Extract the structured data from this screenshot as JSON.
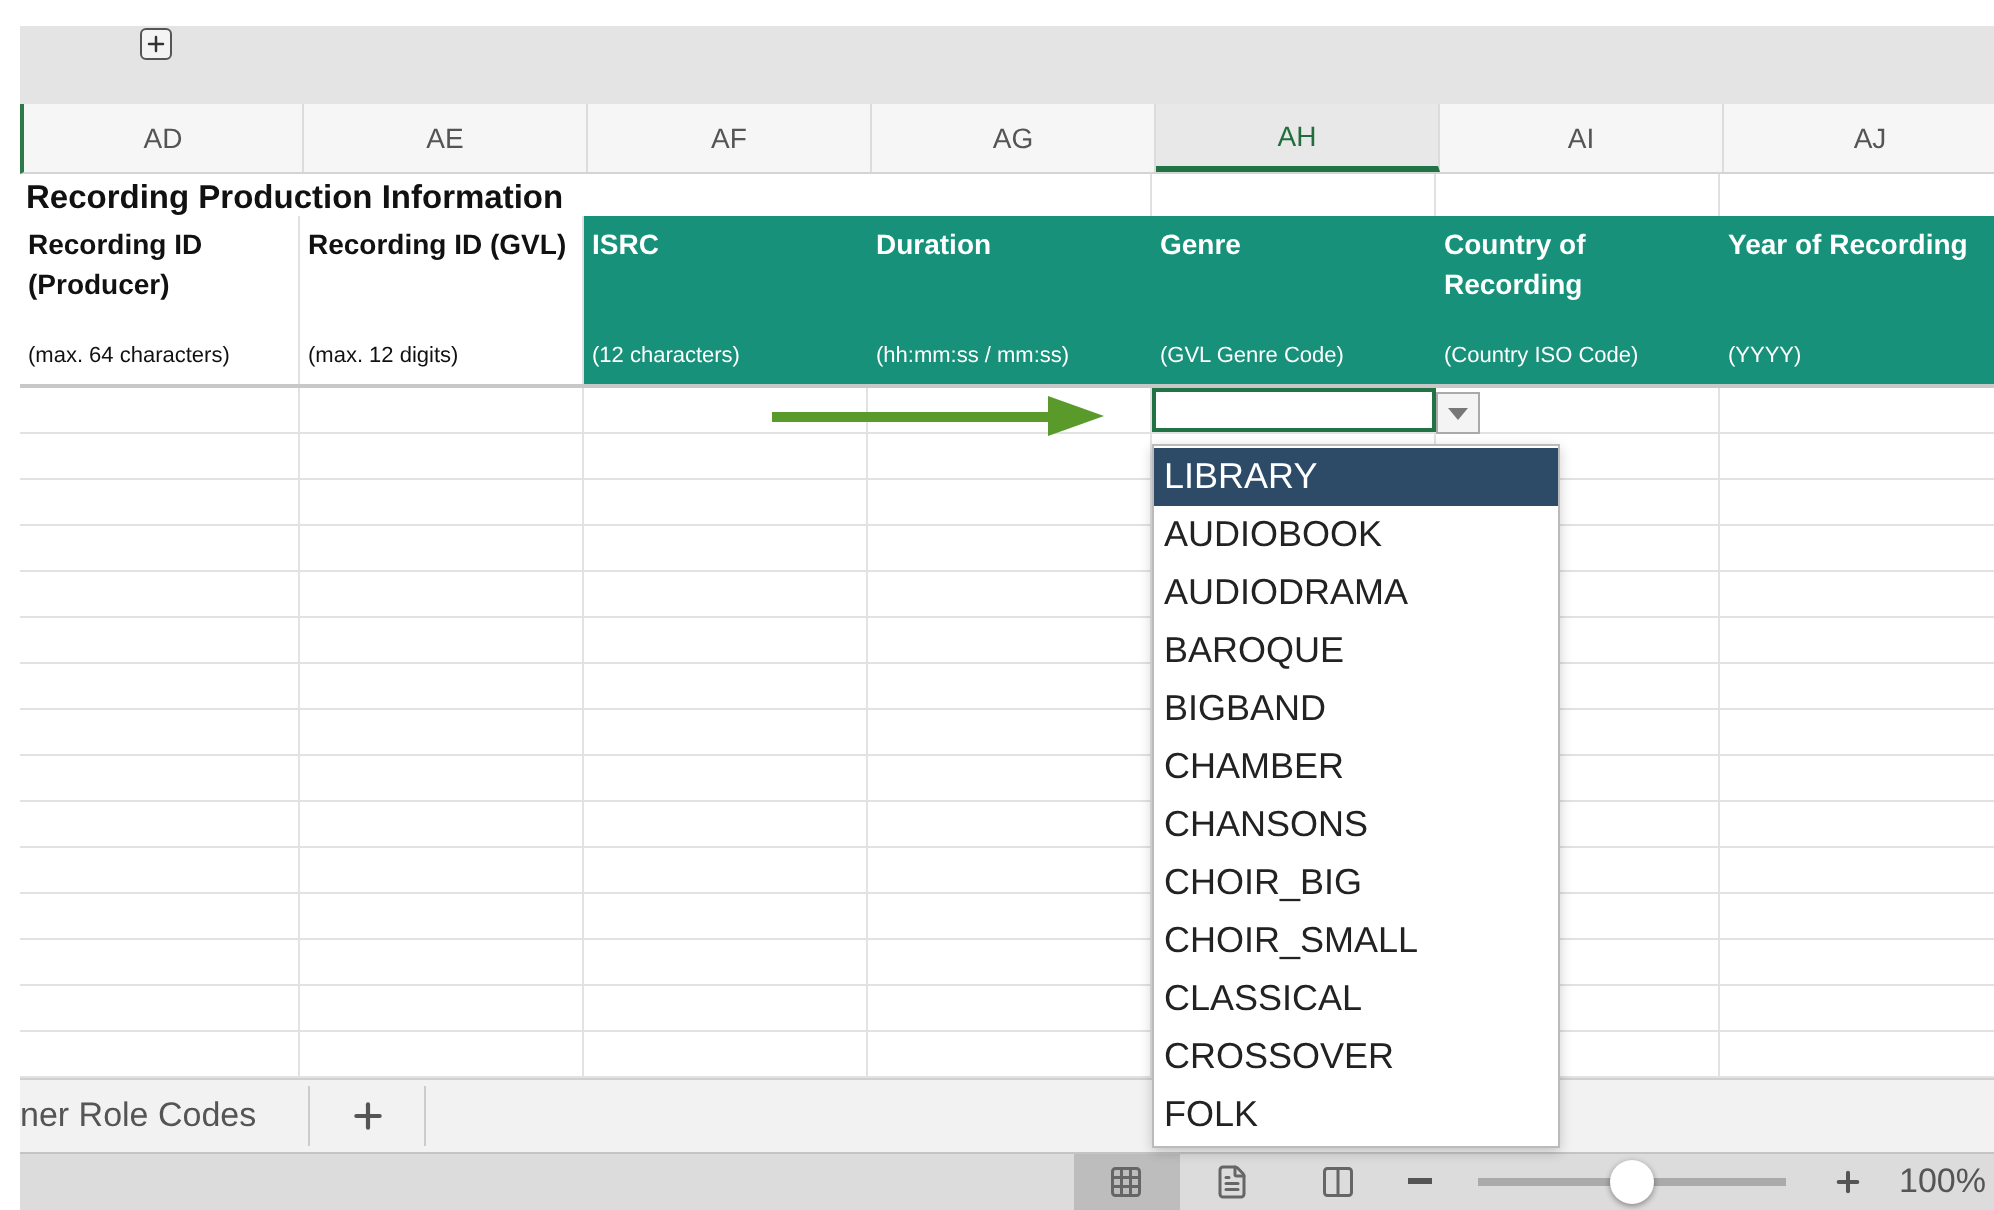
{
  "column_headers": [
    {
      "label": "AD",
      "selected": false
    },
    {
      "label": "AE",
      "selected": false
    },
    {
      "label": "AF",
      "selected": false
    },
    {
      "label": "AG",
      "selected": false
    },
    {
      "label": "AH",
      "selected": true
    },
    {
      "label": "AI",
      "selected": false
    },
    {
      "label": "AJ",
      "selected": false
    }
  ],
  "section_title": "Recording Production Information",
  "fields": [
    {
      "title": "Recording ID (Producer)",
      "hint": "(max. 64 characters)",
      "highlighted": false
    },
    {
      "title": "Recording ID (GVL)",
      "hint": "(max. 12 digits)",
      "highlighted": false
    },
    {
      "title": "ISRC",
      "hint": "(12 characters)",
      "highlighted": true
    },
    {
      "title": "Duration",
      "hint": "(hh:mm:ss / mm:ss)",
      "highlighted": true
    },
    {
      "title": "Genre",
      "hint": "(GVL Genre Code)",
      "highlighted": true
    },
    {
      "title": "Country of Recording",
      "hint": "(Country ISO Code)",
      "highlighted": true
    },
    {
      "title": "Year of Recording",
      "hint": "(YYYY)",
      "highlighted": true
    }
  ],
  "genre_dropdown": {
    "items": [
      {
        "label": "LIBRARY",
        "selected": true
      },
      {
        "label": "AUDIOBOOK",
        "selected": false
      },
      {
        "label": "AUDIODRAMA",
        "selected": false
      },
      {
        "label": "BAROQUE",
        "selected": false
      },
      {
        "label": "BIGBAND",
        "selected": false
      },
      {
        "label": "CHAMBER",
        "selected": false
      },
      {
        "label": "CHANSONS",
        "selected": false
      },
      {
        "label": "CHOIR_BIG",
        "selected": false
      },
      {
        "label": "CHOIR_SMALL",
        "selected": false
      },
      {
        "label": "CLASSICAL",
        "selected": false
      },
      {
        "label": "CROSSOVER",
        "selected": false
      },
      {
        "label": "FOLK",
        "selected": false
      }
    ]
  },
  "sheet_tabs": [
    {
      "label": "ner Role Codes"
    }
  ],
  "views": [
    {
      "kind": "normal",
      "selected": true
    },
    {
      "kind": "page-layout",
      "selected": false
    },
    {
      "kind": "page-break",
      "selected": false
    }
  ],
  "zoom": {
    "level": 0.5,
    "reading": "100%"
  }
}
